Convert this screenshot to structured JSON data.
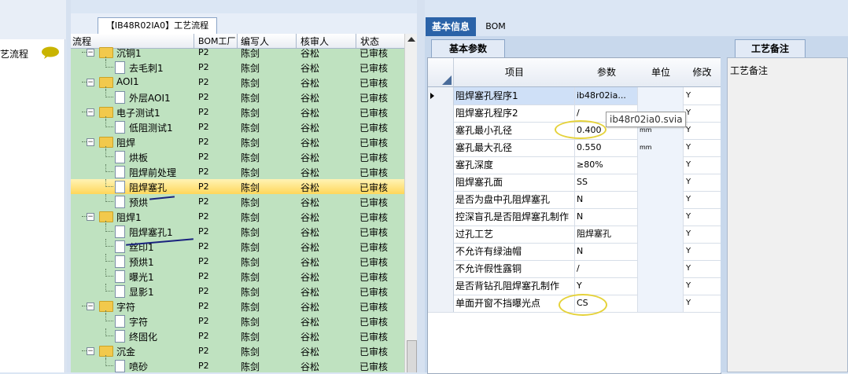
{
  "left_panel": {
    "item_label": "艺流程",
    "item_icon": "speech-bubble-icon"
  },
  "tree": {
    "tab_title": "【IB48R02IA0】工艺流程",
    "headers": {
      "flow": "流程",
      "bom": "BOM工厂",
      "writer": "编写人",
      "reviewer": "核审人",
      "status": "状态"
    },
    "rows": [
      {
        "name": "沉铜1",
        "bom": "P2",
        "writer": "陈剑",
        "reviewer": "谷松",
        "status": "已审核",
        "level": 0,
        "type": "folder"
      },
      {
        "name": "去毛刺1",
        "bom": "P2",
        "writer": "陈剑",
        "reviewer": "谷松",
        "status": "已审核",
        "level": 1,
        "type": "doc"
      },
      {
        "name": "AOI1",
        "bom": "P2",
        "writer": "陈剑",
        "reviewer": "谷松",
        "status": "已审核",
        "level": 0,
        "type": "folder"
      },
      {
        "name": "外层AOI1",
        "bom": "P2",
        "writer": "陈剑",
        "reviewer": "谷松",
        "status": "已审核",
        "level": 1,
        "type": "doc"
      },
      {
        "name": "电子测试1",
        "bom": "P2",
        "writer": "陈剑",
        "reviewer": "谷松",
        "status": "已审核",
        "level": 0,
        "type": "folder"
      },
      {
        "name": "低阻测试1",
        "bom": "P2",
        "writer": "陈剑",
        "reviewer": "谷松",
        "status": "已审核",
        "level": 1,
        "type": "doc"
      },
      {
        "name": "阻焊",
        "bom": "P2",
        "writer": "陈剑",
        "reviewer": "谷松",
        "status": "已审核",
        "level": 0,
        "type": "folder"
      },
      {
        "name": "烘板",
        "bom": "P2",
        "writer": "陈剑",
        "reviewer": "谷松",
        "status": "已审核",
        "level": 1,
        "type": "doc"
      },
      {
        "name": "阻焊前处理",
        "bom": "P2",
        "writer": "陈剑",
        "reviewer": "谷松",
        "status": "已审核",
        "level": 1,
        "type": "doc"
      },
      {
        "name": "阻焊塞孔",
        "bom": "P2",
        "writer": "陈剑",
        "reviewer": "谷松",
        "status": "已审核",
        "level": 1,
        "type": "doc",
        "selected": true
      },
      {
        "name": "预烘",
        "bom": "P2",
        "writer": "陈剑",
        "reviewer": "谷松",
        "status": "已审核",
        "level": 1,
        "type": "doc"
      },
      {
        "name": "阻焊1",
        "bom": "P2",
        "writer": "陈剑",
        "reviewer": "谷松",
        "status": "已审核",
        "level": 0,
        "type": "folder"
      },
      {
        "name": "阻焊塞孔1",
        "bom": "P2",
        "writer": "陈剑",
        "reviewer": "谷松",
        "status": "已审核",
        "level": 1,
        "type": "doc"
      },
      {
        "name": "丝印1",
        "bom": "P2",
        "writer": "陈剑",
        "reviewer": "谷松",
        "status": "已审核",
        "level": 1,
        "type": "doc"
      },
      {
        "name": "预烘1",
        "bom": "P2",
        "writer": "陈剑",
        "reviewer": "谷松",
        "status": "已审核",
        "level": 1,
        "type": "doc"
      },
      {
        "name": "曝光1",
        "bom": "P2",
        "writer": "陈剑",
        "reviewer": "谷松",
        "status": "已审核",
        "level": 1,
        "type": "doc"
      },
      {
        "name": "显影1",
        "bom": "P2",
        "writer": "陈剑",
        "reviewer": "谷松",
        "status": "已审核",
        "level": 1,
        "type": "doc"
      },
      {
        "name": "字符",
        "bom": "P2",
        "writer": "陈剑",
        "reviewer": "谷松",
        "status": "已审核",
        "level": 0,
        "type": "folder"
      },
      {
        "name": "字符",
        "bom": "P2",
        "writer": "陈剑",
        "reviewer": "谷松",
        "status": "已审核",
        "level": 1,
        "type": "doc"
      },
      {
        "name": "终固化",
        "bom": "P2",
        "writer": "陈剑",
        "reviewer": "谷松",
        "status": "已审核",
        "level": 1,
        "type": "doc"
      },
      {
        "name": "沉金",
        "bom": "P2",
        "writer": "陈剑",
        "reviewer": "谷松",
        "status": "已审核",
        "level": 0,
        "type": "folder"
      },
      {
        "name": "喷砂",
        "bom": "P2",
        "writer": "陈剑",
        "reviewer": "谷松",
        "status": "已审核",
        "level": 1,
        "type": "doc"
      }
    ]
  },
  "right": {
    "tabs": [
      {
        "label": "基本信息",
        "active": true
      },
      {
        "label": "BOM",
        "active": false
      }
    ],
    "params_tab": "基本参数",
    "notes_tab": "工艺备注",
    "notes_label": "工艺备注",
    "grid_headers": {
      "item": "项目",
      "param": "参数",
      "unit": "单位",
      "modify": "修改"
    },
    "tooltip": "ib48r02ia0.svia",
    "rows": [
      {
        "item": "阻焊塞孔程序1",
        "param": "ib48r02ia...",
        "unit": "",
        "modify": "Y",
        "current": true
      },
      {
        "item": "阻焊塞孔程序2",
        "param": "/",
        "unit": "",
        "modify": "Y"
      },
      {
        "item": "塞孔最小孔径",
        "param": "0.400",
        "unit": "mm",
        "modify": "Y",
        "circled": true
      },
      {
        "item": "塞孔最大孔径",
        "param": "0.550",
        "unit": "mm",
        "modify": "Y"
      },
      {
        "item": "塞孔深度",
        "param": "≥80%",
        "unit": "",
        "modify": "Y"
      },
      {
        "item": "阻焊塞孔面",
        "param": "SS",
        "unit": "",
        "modify": "Y"
      },
      {
        "item": "是否为盘中孔阻焊塞孔",
        "param": "N",
        "unit": "",
        "modify": "Y"
      },
      {
        "item": "控深盲孔是否阻焊塞孔制作",
        "param": "N",
        "unit": "",
        "modify": "Y"
      },
      {
        "item": "过孔工艺",
        "param": "阻焊塞孔",
        "unit": "",
        "modify": "Y"
      },
      {
        "item": "不允许有绿油帽",
        "param": "N",
        "unit": "",
        "modify": "Y"
      },
      {
        "item": "不允许假性露铜",
        "param": "/",
        "unit": "",
        "modify": "Y"
      },
      {
        "item": "是否背钻孔阻焊塞孔制作",
        "param": "Y",
        "unit": "",
        "modify": "Y"
      },
      {
        "item": "单面开窗不挡曝光点",
        "param": "CS",
        "unit": "",
        "modify": "Y",
        "circled": true
      }
    ]
  },
  "colors": {
    "tree_bg": "#bfe2c0",
    "selection": "#ffd75a",
    "tab_active": "#2b63a8",
    "annotation_ellipse": "#e5d23a",
    "annotation_ink": "#1a237e"
  }
}
